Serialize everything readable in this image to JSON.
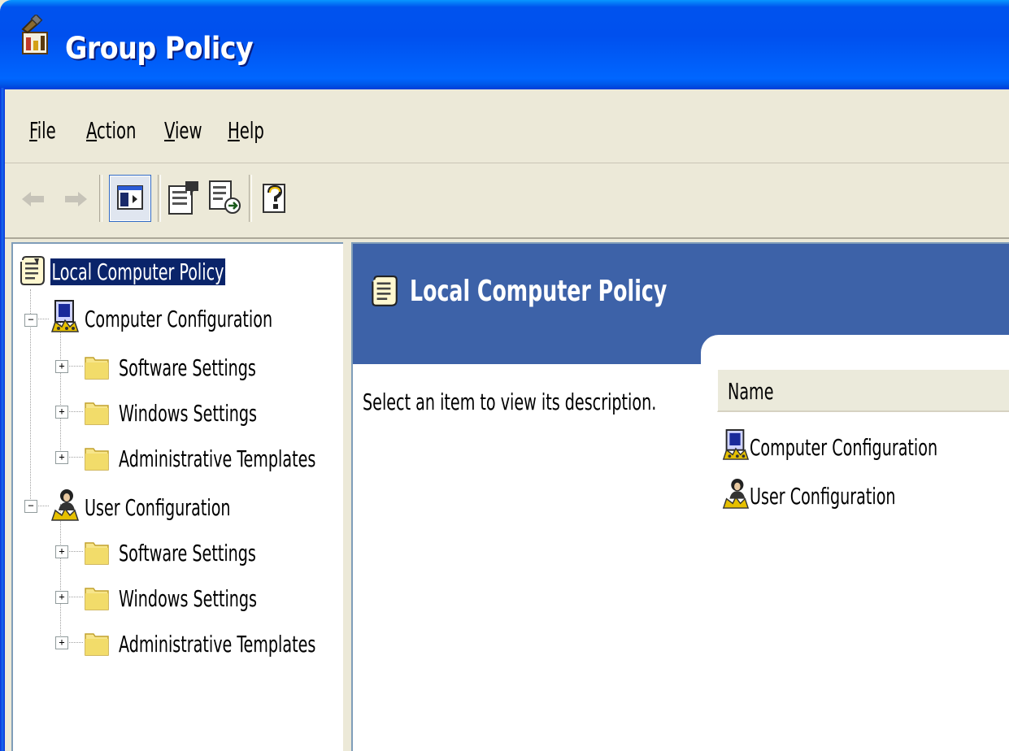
{
  "window": {
    "title": "Group Policy",
    "icon": "group-policy-icon"
  },
  "menu": [
    {
      "label": "File",
      "accel": "F",
      "rest": "ile"
    },
    {
      "label": "Action",
      "accel": "A",
      "rest": "ction"
    },
    {
      "label": "View",
      "accel": "V",
      "rest": "iew"
    },
    {
      "label": "Help",
      "accel": "H",
      "rest": "elp"
    }
  ],
  "toolbar": [
    {
      "name": "back-arrow-icon",
      "enabled": false
    },
    {
      "name": "forward-arrow-icon",
      "enabled": false
    },
    {
      "name": "show-hide-console-tree-icon",
      "enabled": true,
      "pressed": true
    },
    {
      "name": "properties-icon",
      "enabled": true
    },
    {
      "name": "export-list-icon",
      "enabled": true
    },
    {
      "name": "help-icon",
      "enabled": true
    }
  ],
  "tree": {
    "root": "Local Computer Policy",
    "computer": {
      "label": "Computer Configuration",
      "children": [
        "Software Settings",
        "Windows Settings",
        "Administrative Templates"
      ]
    },
    "user": {
      "label": "User Configuration",
      "children": [
        "Software Settings",
        "Windows Settings",
        "Administrative Templates"
      ]
    }
  },
  "details": {
    "title": "Local Computer Policy",
    "description": "Select an item to view its description.",
    "column_name": "Name",
    "items": [
      "Computer Configuration",
      "User Configuration"
    ]
  },
  "colors": {
    "titlebar": "#0054e3",
    "header_band": "#3d62a8",
    "selection": "#0a246a",
    "chrome": "#ece9d8"
  }
}
